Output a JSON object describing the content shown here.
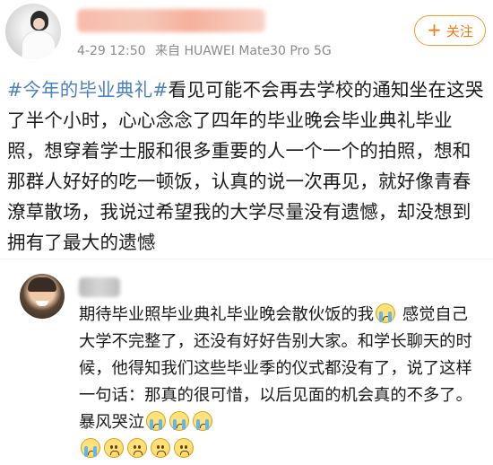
{
  "post": {
    "timestamp": "4-29 12:50",
    "source_label": "来自",
    "device": "HUAWEI Mate30 Pro 5G",
    "follow_label": "关注",
    "hashtag": "#今年的毕业典礼#",
    "body": "看见可能不会再去学校的通知坐在这哭了半个小时，心心念念了四年的毕业晚会毕业典礼毕业照，想穿着学士服和很多重要的人一个一个的拍照，想和那群人好好的吃一顿饭，认真的说一次再见，就好像青春潦草散场，我说过希望我的大学尽量没有遗憾，却没想到拥有了最大的遗憾"
  },
  "comment": {
    "text_part1": "期待毕业照毕业典礼毕业晚会散伙饭的我",
    "text_part2": "感觉自己大学不完整了，还没有好好告别大家。和学长聊天的时候，他得知我们这些毕业季的仪式都没有了，说了这样一句话：那真的很可惜，以后见面的机会真的不多了。",
    "text_part3": "暴风哭泣",
    "emojis": [
      "cry-emoji",
      "cry-emoji",
      "cry-emoji",
      "cry-emoji",
      "frown-emoji",
      "frown-emoji",
      "frown-emoji",
      "frown-emoji"
    ]
  },
  "colors": {
    "hashtag": "#4a7fc0",
    "follow": "#f07a12",
    "meta": "#8a8a8a"
  }
}
